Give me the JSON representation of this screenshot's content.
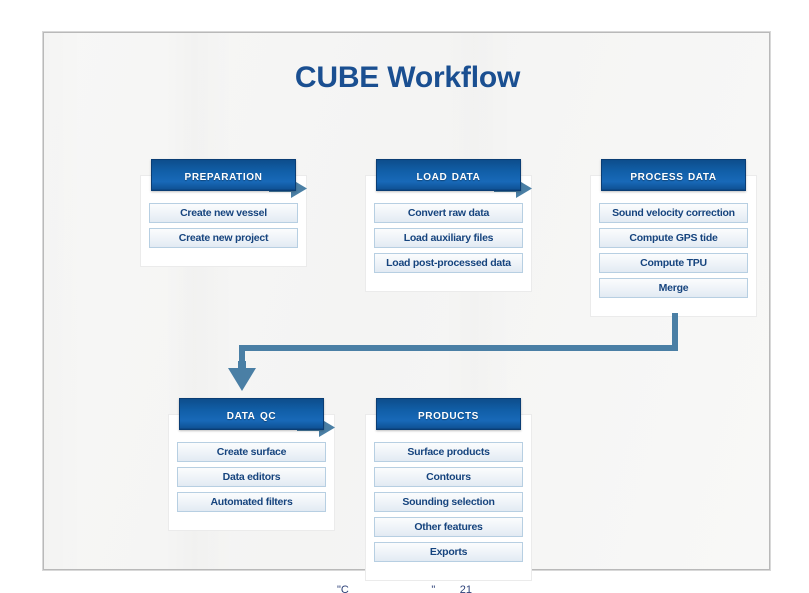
{
  "title": "CUBE Workflow",
  "colors": {
    "title": "#1a4f91",
    "header_blue": "#1160a8",
    "header_border": "#0a3d74",
    "item_text": "#16447e",
    "item_border": "#b7cfe2",
    "arrow": "#4a7fa5",
    "slide_bg": "#f6f6f5",
    "slide_border": "#b9b9b9"
  },
  "groups": [
    {
      "id": "preparation",
      "header": "Preparation",
      "items": [
        "Create new vessel",
        "Create new project"
      ]
    },
    {
      "id": "load-data",
      "header": "Load Data",
      "items": [
        "Convert raw data",
        "Load auxiliary files",
        "Load post-processed data"
      ]
    },
    {
      "id": "process-data",
      "header": "Process Data",
      "items": [
        "Sound velocity correction",
        "Compute GPS tide",
        "Compute TPU",
        "Merge"
      ]
    },
    {
      "id": "data-qc",
      "header": "Data QC",
      "items": [
        "Create surface",
        "Data editors",
        "Automated filters"
      ]
    },
    {
      "id": "products",
      "header": "Products",
      "items": [
        "Surface products",
        "Contours",
        "Sounding selection",
        "Other features",
        "Exports"
      ]
    }
  ],
  "connectors": [
    {
      "id": "prep-to-load",
      "kind": "arrow-right"
    },
    {
      "id": "load-to-process",
      "kind": "arrow-right"
    },
    {
      "id": "process-to-qc",
      "kind": "elbow-down-left"
    },
    {
      "id": "qc-to-products",
      "kind": "arrow-right"
    }
  ],
  "footer": "\"C                           \"        21"
}
